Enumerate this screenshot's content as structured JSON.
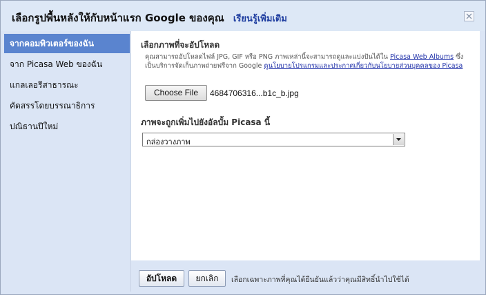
{
  "dialog": {
    "title": "เลือกรูปพื้นหลังให้กับหน้าแรก Google ของคุณ",
    "learn_more": "เรียนรู้เพิ่มเติม",
    "close_glyph": "✕"
  },
  "sidebar": {
    "items": [
      {
        "label": "จากคอมพิวเตอร์ของฉัน",
        "active": true
      },
      {
        "label": "จาก Picasa Web ของฉัน",
        "active": false
      },
      {
        "label": "แกลเลอรีสาธารณะ",
        "active": false
      },
      {
        "label": "คัดสรรโดยบรรณาธิการ",
        "active": false
      },
      {
        "label": "ปณิธานปีใหม่",
        "active": false
      }
    ]
  },
  "upload": {
    "heading": "เลือกภาพที่จะอัปโหลด",
    "desc_text_1": "คุณสามารถอัปโหลดไฟล์ JPG, GIF หรือ PNG ภาพเหล่านี้จะสามารถดูและแบ่งปันได้ใน",
    "desc_link_picasa": "Picasa Web Albums",
    "desc_text_2": "ซึ่งเป็นบริการจัดเก็บภาพถ่ายฟรีจาก Google",
    "desc_link_policy": "ดูนโยบายโปรแกรมและประกาศเกี่ยวกับนโยบายส่วนบุคคลของ Picasa",
    "choose_file_label": "Choose File",
    "file_name": "4684706316...b1c_b.jpg"
  },
  "album": {
    "heading": "ภาพจะถูกเพิ่มไปยังอัลบั้ม Picasa นี้",
    "selected": "กล่องวางภาพ"
  },
  "footer": {
    "upload_label": "อัปโหลด",
    "cancel_label": "ยกเลิก",
    "note": "เลือกเฉพาะภาพที่คุณได้ยืนยันแล้วว่าคุณมีสิทธิ์นำไปใช้ได้"
  },
  "colors": {
    "accent": "#5a84cf",
    "panel_bg": "#dbe5f5",
    "link": "#1f3ea0"
  }
}
